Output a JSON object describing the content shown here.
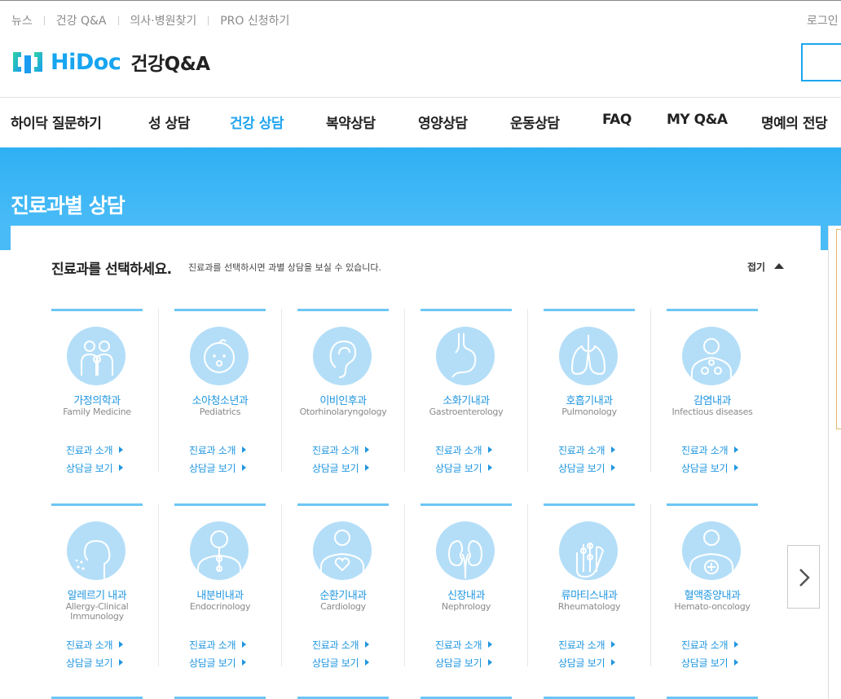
{
  "util_nav": [
    "뉴스",
    "건강 Q&A",
    "의사·병원찾기",
    "PRO 신청하기"
  ],
  "login_label": "로그인",
  "logo": {
    "brand": "HiDoc",
    "section": "건강Q&A"
  },
  "gnb": [
    {
      "label": "하이닥 질문하기",
      "active": false
    },
    {
      "label": "성 상담",
      "active": false
    },
    {
      "label": "건강 상담",
      "active": true
    },
    {
      "label": "복약상담",
      "active": false
    },
    {
      "label": "영양상담",
      "active": false
    },
    {
      "label": "운동상담",
      "active": false
    },
    {
      "label": "FAQ",
      "active": false
    },
    {
      "label": "MY Q&A",
      "active": false
    },
    {
      "label": "명예의 전당",
      "active": false
    }
  ],
  "banner_title": "진료과별 상담",
  "panel": {
    "title": "진료과를 선택하세요.",
    "desc": "진료과를 선택하시면 과별 상담을 보실 수 있습니다.",
    "fold_label": "접기"
  },
  "link_labels": {
    "intro": "진료과 소개",
    "posts": "상담글 보기"
  },
  "departments": [
    {
      "ko": "가정의학과",
      "en": "Family Medicine",
      "icon": "family-icon"
    },
    {
      "ko": "소아청소년과",
      "en": "Pediatrics",
      "icon": "baby-icon"
    },
    {
      "ko": "이비인후과",
      "en": "Otorhinolaryngology",
      "icon": "ear-icon"
    },
    {
      "ko": "소화기내과",
      "en": "Gastroenterology",
      "icon": "stomach-icon"
    },
    {
      "ko": "호흡기내과",
      "en": "Pulmonology",
      "icon": "lungs-icon"
    },
    {
      "ko": "감염내과",
      "en": "Infectious diseases",
      "icon": "virus-icon"
    },
    {
      "ko": "알레르기 내과",
      "en": "Allergy-Clinical Immunology",
      "icon": "allergy-icon"
    },
    {
      "ko": "내분비내과",
      "en": "Endocrinology",
      "icon": "endocrine-icon"
    },
    {
      "ko": "순환기내과",
      "en": "Cardiology",
      "icon": "heart-icon"
    },
    {
      "ko": "신장내과",
      "en": "Nephrology",
      "icon": "kidney-icon"
    },
    {
      "ko": "류마티스내과",
      "en": "Rheumatology",
      "icon": "hand-icon"
    },
    {
      "ko": "혈액종양내과",
      "en": "Hemato-oncology",
      "icon": "blood-icon"
    }
  ],
  "colors": {
    "accent": "#1ea4f0",
    "banner": "#2fb0f4",
    "icon_bg": "#b4def8"
  }
}
